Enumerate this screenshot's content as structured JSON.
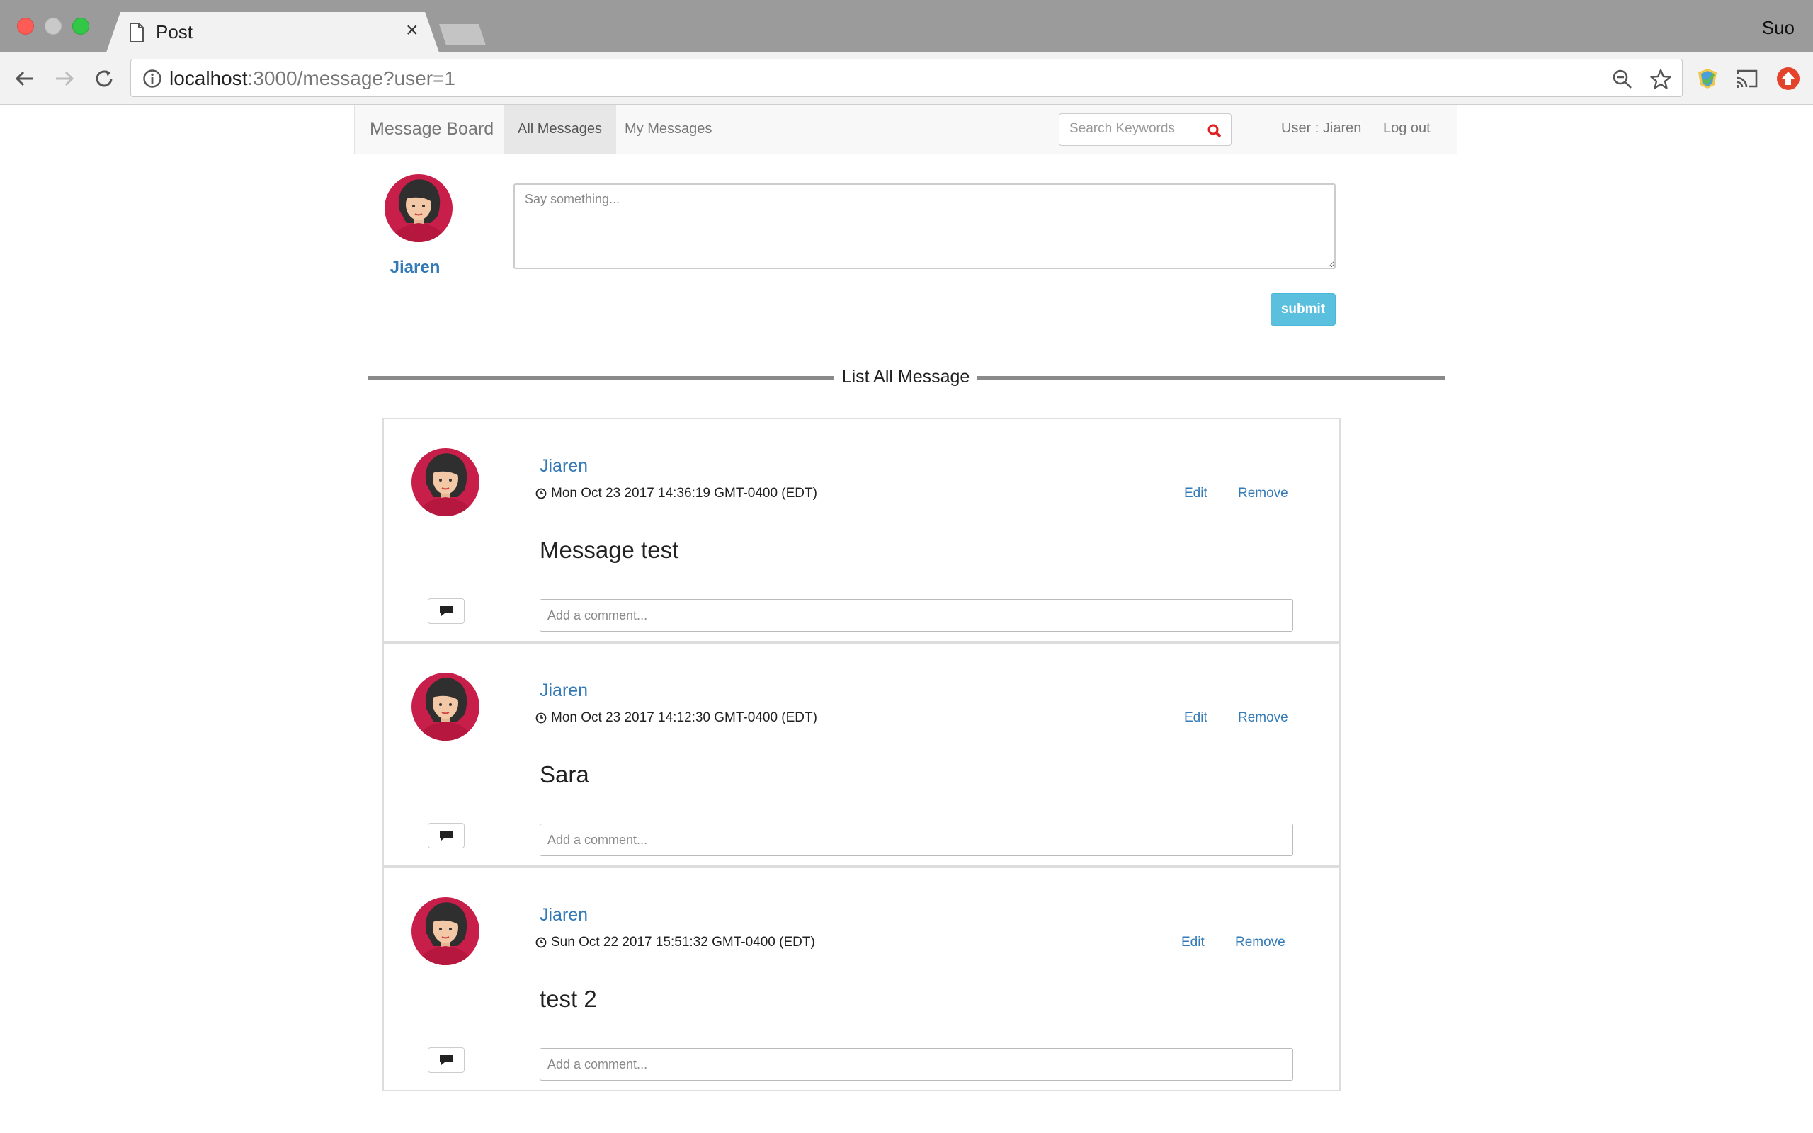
{
  "browser": {
    "tab_title": "Post",
    "close_glyph": "×",
    "profile": "Suo",
    "url_host": "localhost",
    "url_path": ":3000/message?user=1"
  },
  "navbar": {
    "brand": "Message Board",
    "tabs": [
      {
        "label": "All Messages",
        "active": true
      },
      {
        "label": "My Messages",
        "active": false
      }
    ],
    "search_placeholder": "Search Keywords",
    "user_label": "User : Jiaren",
    "logout": "Log out"
  },
  "composer": {
    "user_name": "Jiaren",
    "placeholder": "Say something...",
    "submit_label": "submit"
  },
  "list_title": "List All Message",
  "messages": [
    {
      "author": "Jiaren",
      "time": "Mon Oct 23 2017 14:36:19 GMT-0400 (EDT)",
      "body": "Message test",
      "edit": "Edit",
      "remove": "Remove",
      "comment_placeholder": "Add a comment..."
    },
    {
      "author": "Jiaren",
      "time": "Mon Oct 23 2017 14:12:30 GMT-0400 (EDT)",
      "body": "Sara",
      "edit": "Edit",
      "remove": "Remove",
      "comment_placeholder": "Add a comment..."
    },
    {
      "author": "Jiaren",
      "time": "Sun Oct 22 2017 15:51:32 GMT-0400 (EDT)",
      "body": "test 2",
      "edit": "Edit",
      "remove": "Remove",
      "comment_placeholder": "Add a comment..."
    }
  ],
  "colors": {
    "link": "#337ab7",
    "submit": "#5bc0de",
    "search_icon": "#e02020",
    "avatar_shirt": "#c81f4a"
  },
  "icons": [
    "page-icon",
    "close-icon",
    "back-icon",
    "forward-icon",
    "reload-icon",
    "info-icon",
    "zoom-icon",
    "star-icon",
    "extension-icon",
    "cast-icon",
    "update-icon",
    "search-icon",
    "avatar-icon",
    "clock-icon",
    "comment-icon"
  ]
}
